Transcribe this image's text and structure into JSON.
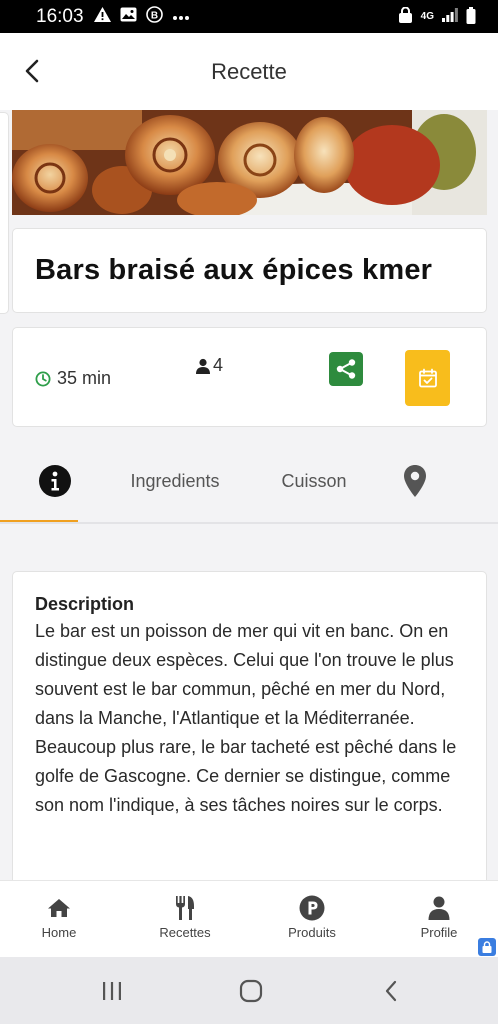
{
  "status_bar": {
    "time": "16:03",
    "network": "4G",
    "icons_left": [
      "warning-icon",
      "image-icon",
      "b-icon",
      "more-icon"
    ],
    "icons_right": [
      "lock-icon",
      "network-icon",
      "signal-icon",
      "battery-icon"
    ]
  },
  "header": {
    "title": "Recette",
    "back_icon": "chevron-left-icon"
  },
  "recipe": {
    "title": "Bars braisé aux épices kmer",
    "time": "35 min",
    "servings": "4",
    "share_icon": "share-icon",
    "calendar_icon": "calendar-check-icon"
  },
  "tabs": [
    {
      "label": "",
      "icon": "info-icon",
      "active": true
    },
    {
      "label": "Ingredients",
      "active": false
    },
    {
      "label": "Cuisson",
      "active": false
    },
    {
      "label": "",
      "icon": "map-marker-icon",
      "active": false
    }
  ],
  "description": {
    "heading": "Description",
    "text": "Le bar est un poisson de mer qui vit en banc. On en distingue deux espèces. Celui que l'on trouve le plus souvent est le bar commun, pêché en mer du Nord, dans la Manche, l'Atlantique et la Méditerranée. Beaucoup plus rare, le bar tacheté est pêché dans le golfe de Gascogne. Ce dernier se distingue, comme son nom l'indique, à ses tâches noires sur le corps."
  },
  "bottom_nav": [
    {
      "label": "Home",
      "icon": "home-icon"
    },
    {
      "label": "Recettes",
      "icon": "utensils-icon"
    },
    {
      "label": "Produits",
      "icon": "parking-circle-icon"
    },
    {
      "label": "Profile",
      "icon": "user-icon"
    }
  ],
  "system_nav": [
    "recents-icon",
    "home-circle-icon",
    "back-icon"
  ],
  "colors": {
    "accent": "#f0a020",
    "share_green": "#2e8b3e",
    "calendar_yellow": "#f8bd1c",
    "clock_green": "#2e9e4a"
  }
}
